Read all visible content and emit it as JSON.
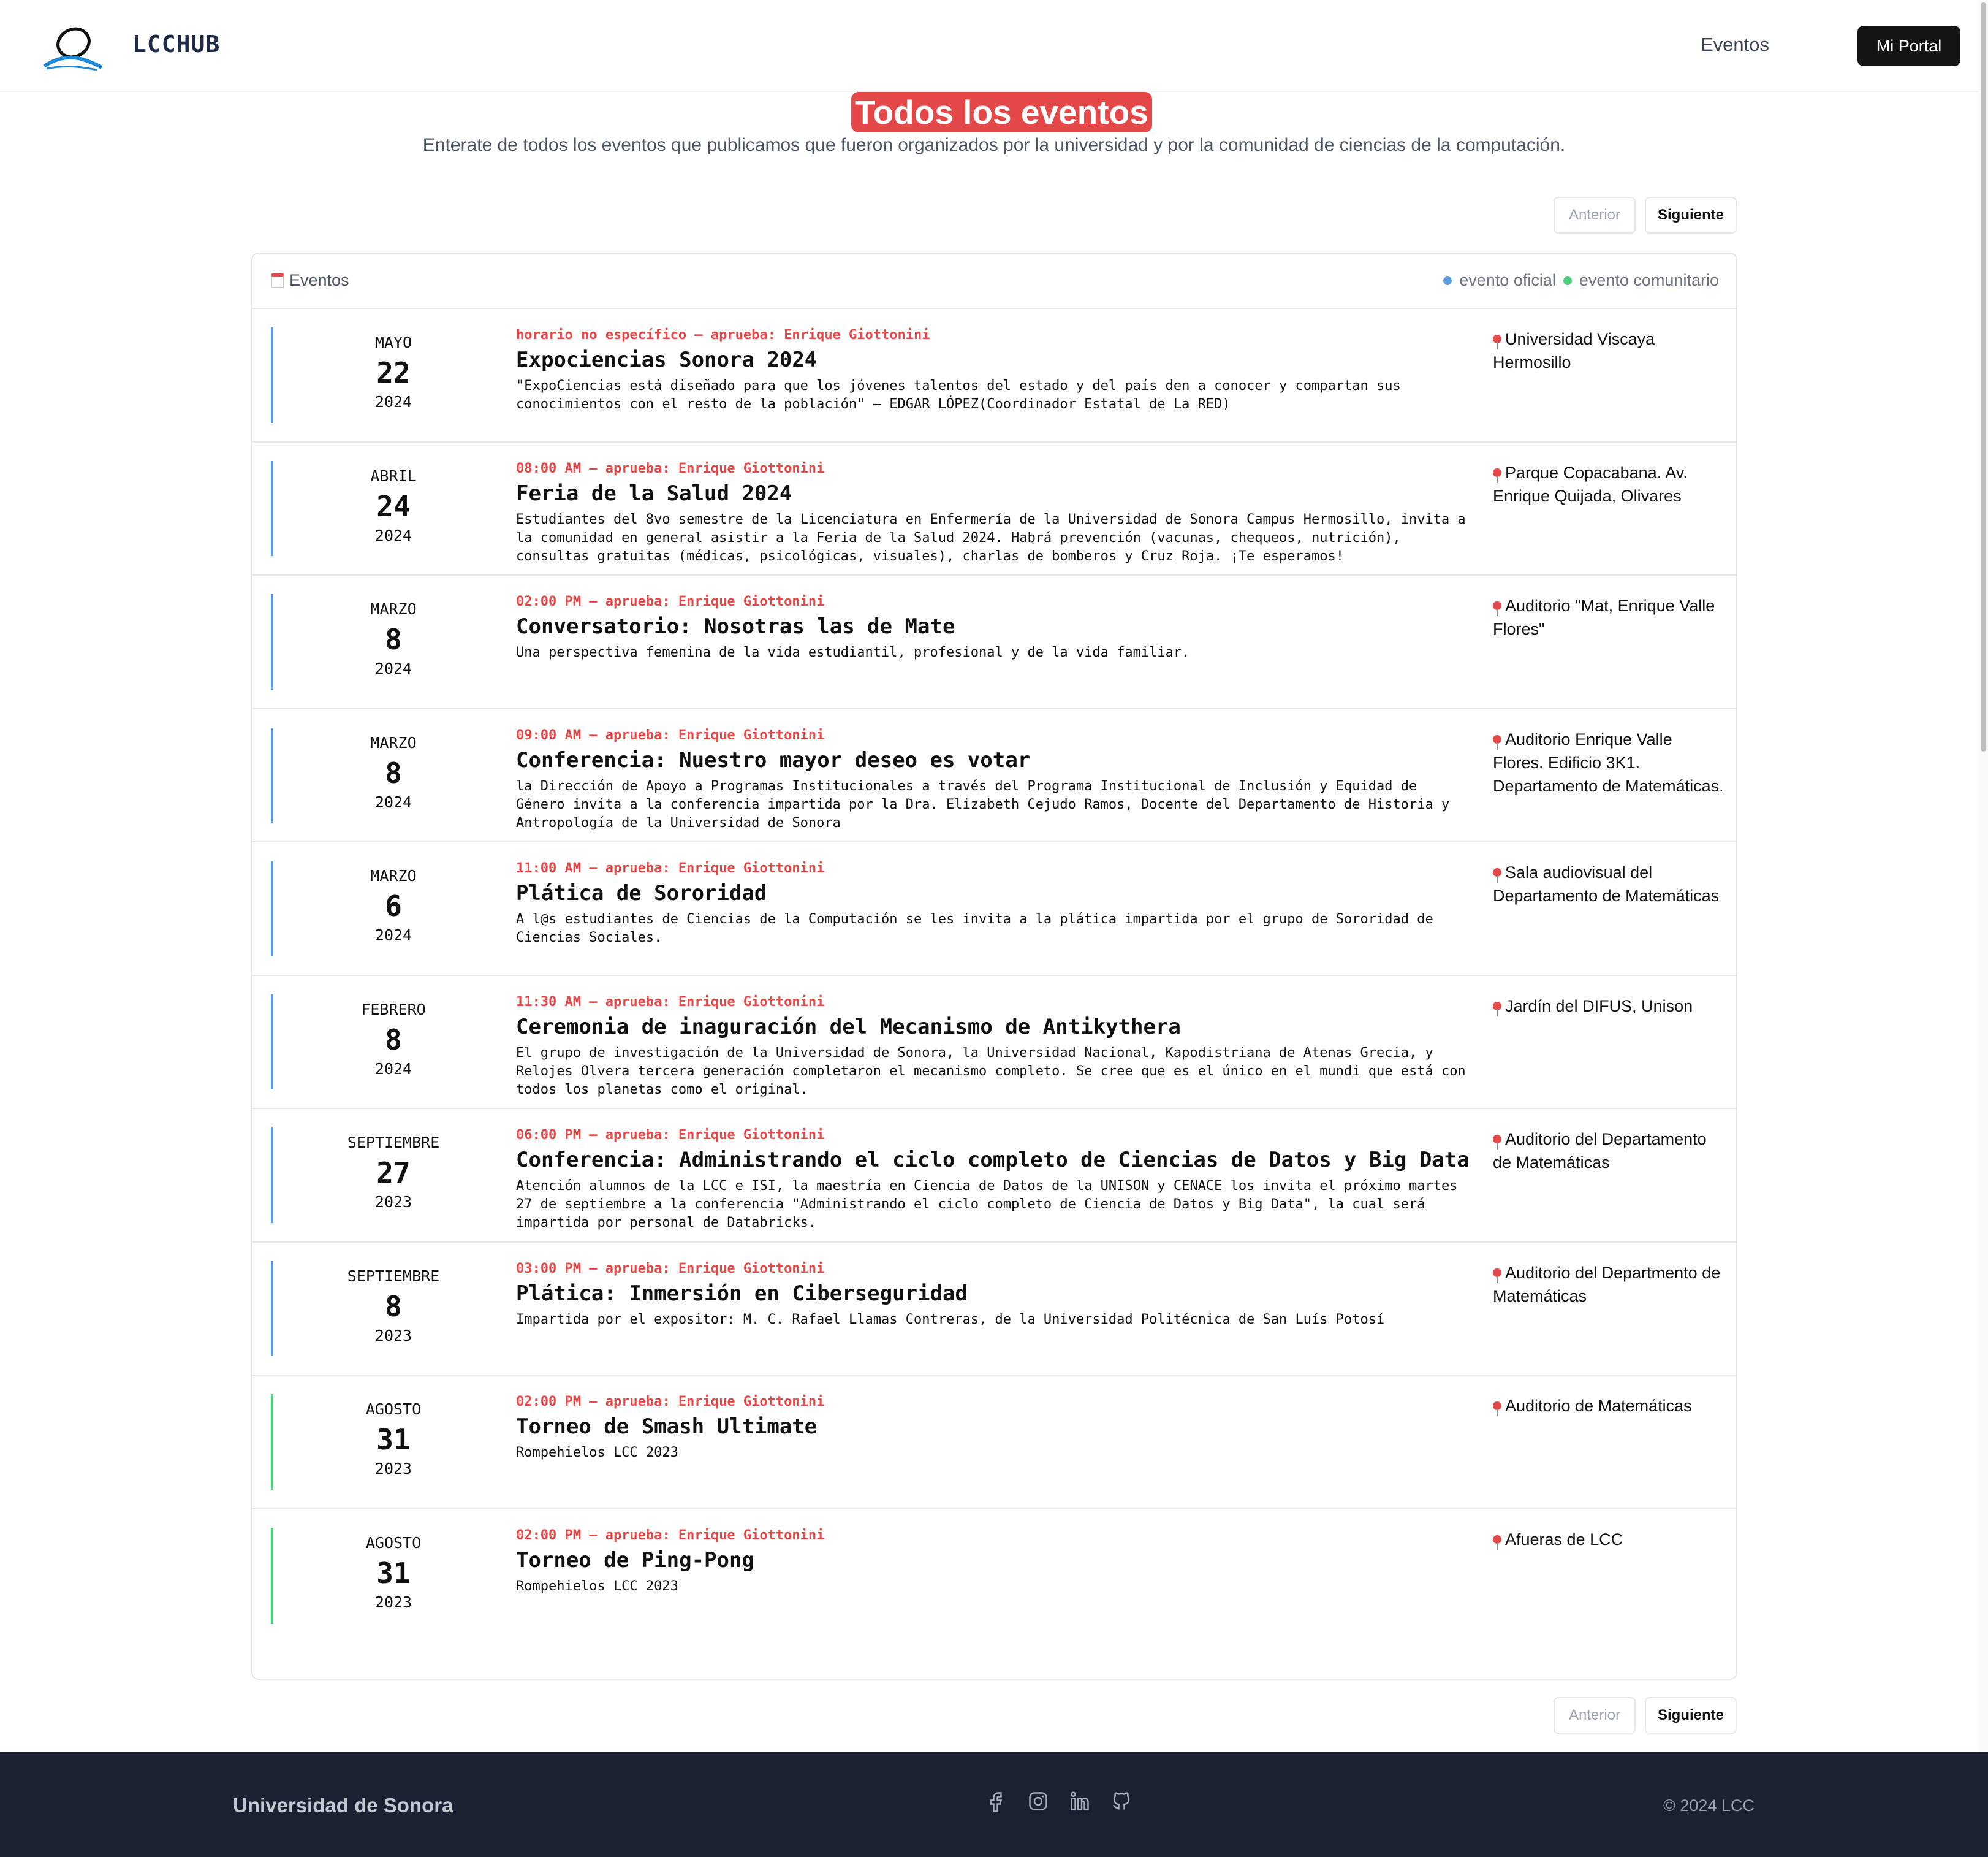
{
  "header": {
    "brand": "LCCHUB",
    "nav_eventos": "Eventos",
    "portal_button": "Mi Portal"
  },
  "page": {
    "title": "Todos los eventos",
    "subtitle": "Enterate de todos los eventos que publicamos que fueron organizados por la universidad y por la comunidad de ciencias de la computación."
  },
  "pager": {
    "prev": "Anterior",
    "next": "Siguiente"
  },
  "card": {
    "heading": "Eventos",
    "legend_official": "evento oficial",
    "legend_community": "evento comunitario",
    "colors": {
      "official": "#5b9ee0",
      "community": "#4ccf79",
      "accent": "#e54848"
    }
  },
  "events": [
    {
      "month": "MAYO",
      "day": "22",
      "year": "2024",
      "meta": "horario no específico – aprueba: Enrique Giottonini",
      "title": "Expociencias Sonora 2024",
      "description": "\"ExpoCiencias está diseñado para que los jóvenes talentos del estado y del país den a conocer y compartan sus conocimientos con el resto de la población\" – EDGAR LÓPEZ(Coordinador Estatal de La RED)",
      "location": "Universidad Viscaya Hermosillo",
      "type": "official"
    },
    {
      "month": "ABRIL",
      "day": "24",
      "year": "2024",
      "meta": "08:00 AM – aprueba: Enrique Giottonini",
      "title": "Feria de la Salud 2024",
      "description": "Estudiantes del 8vo semestre de la Licenciatura en Enfermería de la Universidad de Sonora Campus Hermosillo, invita a la comunidad en general asistir a la Feria de la Salud 2024. Habrá prevención (vacunas, chequeos, nutrición), consultas gratuitas (médicas, psicológicas, visuales), charlas de bomberos y Cruz Roja. ¡Te esperamos!",
      "location": "Parque Copacabana. Av. Enrique Quijada, Olivares",
      "type": "official"
    },
    {
      "month": "MARZO",
      "day": "8",
      "year": "2024",
      "meta": "02:00 PM – aprueba: Enrique Giottonini",
      "title": "Conversatorio: Nosotras las de Mate",
      "description": "Una perspectiva femenina de la vida estudiantil, profesional y de la vida familiar.",
      "location": "Auditorio \"Mat, Enrique Valle Flores\"",
      "type": "official"
    },
    {
      "month": "MARZO",
      "day": "8",
      "year": "2024",
      "meta": "09:00 AM – aprueba: Enrique Giottonini",
      "title": "Conferencia: Nuestro mayor deseo es votar",
      "description": "la Dirección de Apoyo a Programas Institucionales a través del Programa Institucional de Inclusión y Equidad de Género invita a la conferencia impartida por la Dra. Elizabeth Cejudo Ramos, Docente del Departamento de Historia y Antropología de la Universidad de Sonora",
      "location": "Auditorio Enrique Valle Flores. Edificio 3K1. Departamento de Matemáticas.",
      "type": "official"
    },
    {
      "month": "MARZO",
      "day": "6",
      "year": "2024",
      "meta": "11:00 AM – aprueba: Enrique Giottonini",
      "title": "Plática de Sororidad",
      "description": "A l@s estudiantes de Ciencias de la Computación se les invita a la plática impartida por el grupo de Sororidad de Ciencias Sociales.",
      "location": "Sala audiovisual del Departamento de Matemáticas",
      "type": "official"
    },
    {
      "month": "FEBRERO",
      "day": "8",
      "year": "2024",
      "meta": "11:30 AM – aprueba: Enrique Giottonini",
      "title": "Ceremonia de inaguración del Mecanismo de Antikythera",
      "description": "El grupo de investigación de la Universidad de Sonora, la Universidad Nacional, Kapodistriana de Atenas Grecia, y Relojes Olvera tercera generación completaron el mecanismo completo. Se cree que es el único en el mundi que está con todos los planetas como el original.",
      "location": "Jardín del DIFUS, Unison",
      "type": "official"
    },
    {
      "month": "SEPTIEMBRE",
      "day": "27",
      "year": "2023",
      "meta": "06:00 PM – aprueba: Enrique Giottonini",
      "title": "Conferencia: Administrando el ciclo completo de Ciencias de Datos y Big Data",
      "description": "Atención alumnos de la LCC e ISI, la maestría en Ciencia de Datos de la UNISON y CENACE los invita el próximo martes 27 de septiembre a la conferencia \"Administrando el ciclo completo de Ciencia de Datos y Big Data\", la cual será impartida por personal de Databricks.",
      "location": "Auditorio del Departamento de Matemáticas",
      "type": "official"
    },
    {
      "month": "SEPTIEMBRE",
      "day": "8",
      "year": "2023",
      "meta": "03:00 PM – aprueba: Enrique Giottonini",
      "title": "Plática: Inmersión en Ciberseguridad",
      "description": "Impartida por el expositor: M. C. Rafael Llamas Contreras, de la Universidad Politécnica de San Luís Potosí",
      "location": "Auditorio del Departmento de Matemáticas",
      "type": "official"
    },
    {
      "month": "AGOSTO",
      "day": "31",
      "year": "2023",
      "meta": "02:00 PM – aprueba: Enrique Giottonini",
      "title": "Torneo de Smash Ultimate",
      "description": "Rompehielos LCC 2023",
      "location": "Auditorio de Matemáticas",
      "type": "community"
    },
    {
      "month": "AGOSTO",
      "day": "31",
      "year": "2023",
      "meta": "02:00 PM – aprueba: Enrique Giottonini",
      "title": "Torneo de Ping-Pong",
      "description": "Rompehielos LCC 2023",
      "location": "Afueras de LCC",
      "type": "community"
    }
  ],
  "footer": {
    "left": "Universidad de Sonora",
    "right": "© 2024 LCC",
    "socials": [
      "facebook-icon",
      "instagram-icon",
      "linkedin-icon",
      "github-icon"
    ]
  }
}
